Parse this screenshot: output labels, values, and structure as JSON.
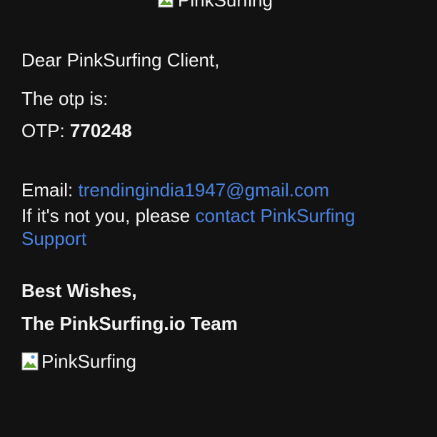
{
  "header_logo": {
    "alt": "PinkSurfing",
    "icon": "broken-image-icon"
  },
  "greeting": "Dear PinkSurfing Client,",
  "otp_intro": "The otp is:",
  "otp": {
    "label": "OTP: ",
    "value": "770248"
  },
  "email": {
    "label": "Email: ",
    "address": "trendingindia1947@gmail.com"
  },
  "support": {
    "prefix": "If it's not you, please ",
    "link_line1": "contact PinkSurfing",
    "link_line2": "Support"
  },
  "signoff": {
    "wishes": "Best Wishes,",
    "team": "The PinkSurfing.io Team"
  },
  "footer_logo": {
    "alt": "PinkSurfing",
    "icon": "broken-image-icon"
  },
  "colors": {
    "background": "#121212",
    "text": "#f2f2f2",
    "link": "#4a83e0"
  }
}
